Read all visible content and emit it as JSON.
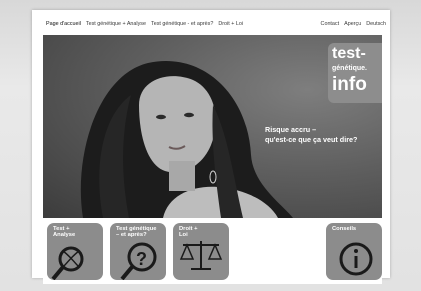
{
  "nav": {
    "left": [
      "Page d'accueil",
      "Test génétique + Analyse",
      "Test génétique - et après?",
      "Droit + Loi"
    ],
    "right": [
      "Contact",
      "Aperçu",
      "Deutsch"
    ]
  },
  "logo": {
    "line1": "test-",
    "line2": "génétique.",
    "line3": "info"
  },
  "hero": {
    "tagline_line1": "Risque accru –",
    "tagline_line2": "qu'est-ce que ça veut dire?"
  },
  "tiles": [
    {
      "label": "Test +\nAnalyse",
      "icon": "dna-magnifier-icon"
    },
    {
      "label": "Test génétique\n– et après?",
      "icon": "question-magnifier-icon"
    },
    {
      "label": "Droit +\nLoi",
      "icon": "scales-icon"
    },
    {
      "label": "Conseils",
      "icon": "info-icon"
    }
  ],
  "colors": {
    "tile_bg": "#8c8c8c",
    "page_bg": "#ffffff",
    "text": "#ffffff"
  }
}
